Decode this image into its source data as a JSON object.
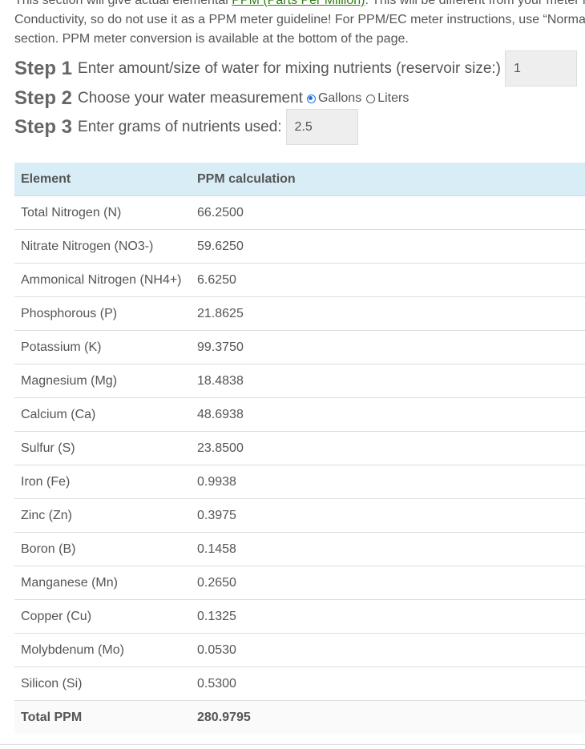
{
  "intro": {
    "line1_pre": "This section will give actual elemental ",
    "line1_link": "PPM (Parts Per Million)",
    "line1_post": ". This will be different from your meter r",
    "line2": "Conductivity, so do not use it as a PPM meter guideline!  For PPM/EC meter instructions, use “Norma",
    "line3": "section.  PPM meter conversion is available at the bottom of the page."
  },
  "step1": {
    "label": "Step 1",
    "text": "Enter amount/size of water for mixing nutrients (reservoir size:)",
    "value": "1"
  },
  "step2": {
    "label": "Step 2",
    "text": "Choose your water measurement",
    "option1": "Gallons",
    "option2": "Liters",
    "selected": "Gallons"
  },
  "step3": {
    "label": "Step 3",
    "text": "Enter grams of nutrients used:",
    "value": "2.5"
  },
  "table": {
    "headers": [
      "Element",
      "PPM calculation"
    ],
    "rows": [
      [
        "Total Nitrogen (N)",
        "66.2500"
      ],
      [
        "Nitrate Nitrogen (NO3-)",
        "59.6250"
      ],
      [
        "Ammonical Nitrogen (NH4+)",
        "6.6250"
      ],
      [
        "Phosphorous (P)",
        "21.8625"
      ],
      [
        "Potassium (K)",
        "99.3750"
      ],
      [
        "Magnesium (Mg)",
        "18.4838"
      ],
      [
        "Calcium (Ca)",
        "48.6938"
      ],
      [
        "Sulfur (S)",
        "23.8500"
      ],
      [
        "Iron (Fe)",
        "0.9938"
      ],
      [
        "Zinc (Zn)",
        "0.3975"
      ],
      [
        "Boron (B)",
        "0.1458"
      ],
      [
        "Manganese (Mn)",
        "0.2650"
      ],
      [
        "Copper (Cu)",
        "0.1325"
      ],
      [
        "Molybdenum (Mo)",
        "0.0530"
      ],
      [
        "Silicon (Si)",
        "0.5300"
      ]
    ],
    "total": [
      "Total PPM",
      "280.9795"
    ]
  },
  "colors": {
    "header_bg": "#d9edf7",
    "link": "#2e7d12",
    "radio_accent": "#1a73e8"
  }
}
